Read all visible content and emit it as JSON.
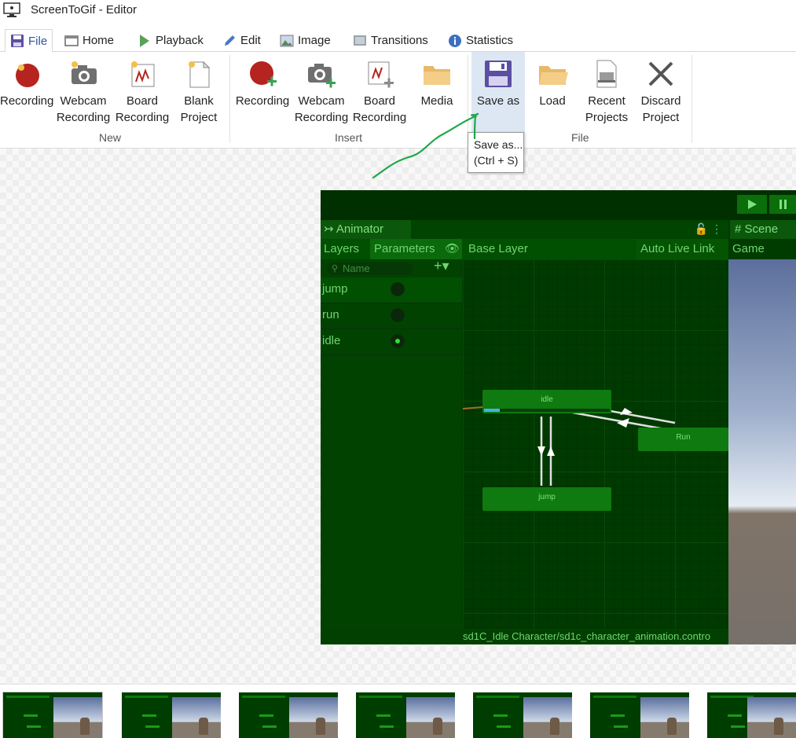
{
  "window": {
    "title": "ScreenToGif - Editor"
  },
  "tabs": [
    {
      "label": "File",
      "icon": "save-icon"
    },
    {
      "label": "Home",
      "icon": "home-icon"
    },
    {
      "label": "Playback",
      "icon": "play-icon"
    },
    {
      "label": "Edit",
      "icon": "pencil-icon"
    },
    {
      "label": "Image",
      "icon": "image-icon"
    },
    {
      "label": "Transitions",
      "icon": "transitions-icon"
    },
    {
      "label": "Statistics",
      "icon": "info-icon"
    }
  ],
  "ribbon": {
    "new": {
      "label": "New",
      "recording": {
        "line1": "Recording",
        "line2": ""
      },
      "webcam": {
        "line1": "Webcam",
        "line2": "Recording"
      },
      "board": {
        "line1": "Board",
        "line2": "Recording"
      },
      "blank": {
        "line1": "Blank",
        "line2": "Project"
      }
    },
    "insert": {
      "label": "Insert",
      "recording": {
        "line1": "Recording",
        "line2": ""
      },
      "webcam": {
        "line1": "Webcam",
        "line2": "Recording"
      },
      "board": {
        "line1": "Board",
        "line2": "Recording"
      },
      "media": {
        "line1": "Media",
        "line2": ""
      }
    },
    "file": {
      "label": "File",
      "save_as": {
        "line1": "Save as",
        "line2": ""
      },
      "load": {
        "line1": "Load",
        "line2": ""
      },
      "recent": {
        "line1": "Recent",
        "line2": "Projects"
      },
      "discard": {
        "line1": "Discard",
        "line2": "Project"
      }
    }
  },
  "tooltip": {
    "line1": "Save as...",
    "line2": "(Ctrl + S)"
  },
  "frame": {
    "animator_tab": "Animator",
    "scene_tab": "Scene",
    "layers_tab": "Layers",
    "parameters_tab": "Parameters",
    "base_layer": "Base Layer",
    "auto_live_link": "Auto Live Link",
    "game_tab": "Game",
    "search_placeholder": "Name",
    "params": [
      {
        "name": "jump",
        "on": false
      },
      {
        "name": "run",
        "on": false
      },
      {
        "name": "idle",
        "on": true
      }
    ],
    "states": {
      "idle": "idle",
      "run": "Run",
      "jump": "jump"
    },
    "status": "sd1C_Idle Character/sd1c_character_animation.contro"
  },
  "colors": {
    "accent": "#2b579a",
    "highlight": "#dde7f4",
    "annotation": "#1fa84a"
  }
}
